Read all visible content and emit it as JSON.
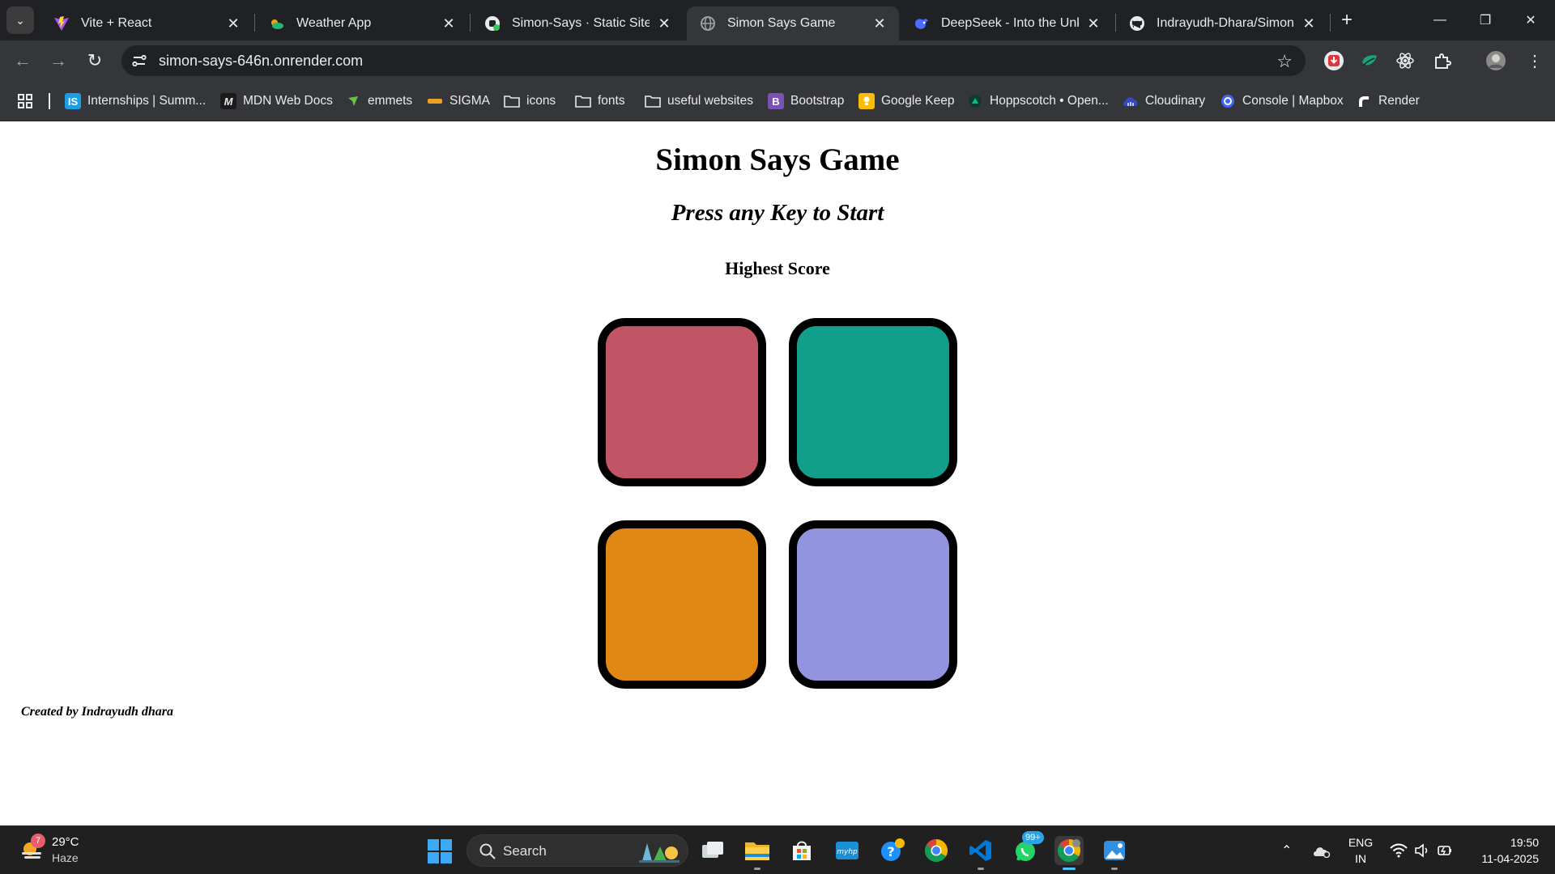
{
  "browser": {
    "tabs": [
      {
        "title": "Vite + React",
        "icon": "vite-icon",
        "active": false
      },
      {
        "title": "Weather App",
        "icon": "weather-cloud-icon",
        "active": false
      },
      {
        "title": "Simon-Says · Static Site · R",
        "icon": "render-icon",
        "active": false
      },
      {
        "title": "Simon Says Game",
        "icon": "globe-icon",
        "active": true
      },
      {
        "title": "DeepSeek - Into the Unkno",
        "icon": "deepseek-icon",
        "active": false
      },
      {
        "title": "Indrayudh-Dhara/Simon-S",
        "icon": "github-icon",
        "active": false
      }
    ],
    "url": "simon-says-646n.onrender.com",
    "bookmarks": [
      {
        "label": "Internships | Summ...",
        "icon": "internshala-icon",
        "color": "#1a9ee6"
      },
      {
        "label": "MDN Web Docs",
        "icon": "mdn-icon",
        "color": "#1b1b1b"
      },
      {
        "label": "emmets",
        "icon": "emmet-icon",
        "color": "#6abf4b"
      },
      {
        "label": "SIGMA",
        "icon": "sigma-icon",
        "color": "#f0a020"
      },
      {
        "label": "icons",
        "icon": "folder-icon",
        "color": "#e8eaed"
      },
      {
        "label": "fonts",
        "icon": "folder-icon",
        "color": "#e8eaed"
      },
      {
        "label": "useful websites",
        "icon": "folder-icon",
        "color": "#e8eaed"
      },
      {
        "label": "Bootstrap",
        "icon": "bootstrap-icon",
        "color": "#7952b3"
      },
      {
        "label": "Google Keep",
        "icon": "google-keep-icon",
        "color": "#fbbc04"
      },
      {
        "label": "Hoppscotch • Open...",
        "icon": "hoppscotch-icon",
        "color": "#10b981"
      },
      {
        "label": "Cloudinary",
        "icon": "cloudinary-icon",
        "color": "#3448c5"
      },
      {
        "label": "Console | Mapbox",
        "icon": "mapbox-icon",
        "color": "#4264fb"
      },
      {
        "label": "Render",
        "icon": "render-icon",
        "color": "#ffffff"
      }
    ]
  },
  "game": {
    "title": "Simon Says Game",
    "status": "Press any Key to Start",
    "score_label": "Highest Score",
    "buttons": [
      {
        "id": "red",
        "color": "#c25565"
      },
      {
        "id": "green",
        "color": "#119e8b"
      },
      {
        "id": "orange",
        "color": "#e08813"
      },
      {
        "id": "purple",
        "color": "#9394de"
      }
    ],
    "credit": "Created by Indrayudh dhara"
  },
  "taskbar": {
    "weather": {
      "temp": "29°C",
      "condition": "Haze",
      "badge": "7"
    },
    "search_placeholder": "Search",
    "whatsapp_badge": "99+",
    "language": {
      "line1": "ENG",
      "line2": "IN"
    },
    "clock": {
      "time": "19:50",
      "date": "11-04-2025"
    }
  }
}
